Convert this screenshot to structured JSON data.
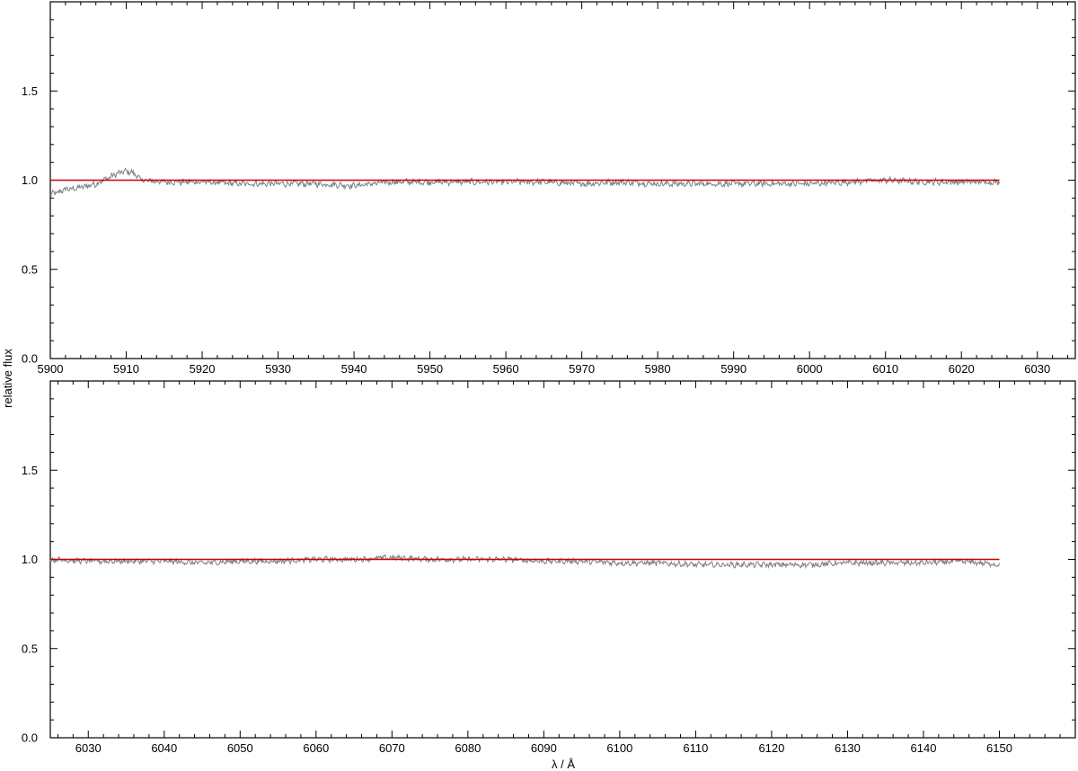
{
  "chart_data": [
    {
      "type": "line",
      "xlim": [
        5900,
        6035
      ],
      "ylim": [
        0,
        2
      ],
      "xticks": [
        5900,
        5910,
        5920,
        5930,
        5940,
        5950,
        5960,
        5970,
        5980,
        5990,
        6000,
        6010,
        6020,
        6030
      ],
      "xtick_labels": [
        "5900",
        "5910",
        "5920",
        "5930",
        "5940",
        "5950",
        "5960",
        "5970",
        "5980",
        "5990",
        "6000",
        "6010",
        "6020",
        "6030"
      ],
      "yticks": [
        0.0,
        0.5,
        1.0,
        1.5
      ],
      "ytick_labels": [
        "0.0",
        "0.5",
        "1.0",
        "1.5"
      ],
      "grid": false,
      "series": [
        {
          "role": "observed spectrum",
          "color": "#808080",
          "x_range": [
            5900,
            6025
          ],
          "points": [
            [
              5900,
              0.92
            ],
            [
              5901,
              0.93
            ],
            [
              5902,
              0.95
            ],
            [
              5903,
              0.95
            ],
            [
              5904,
              0.96
            ],
            [
              5905,
              0.97
            ],
            [
              5906,
              0.98
            ],
            [
              5907,
              1.0
            ],
            [
              5908,
              1.02
            ],
            [
              5909,
              1.04
            ],
            [
              5910,
              1.05
            ],
            [
              5911,
              1.04
            ],
            [
              5912,
              1.0
            ],
            [
              5915,
              0.99
            ],
            [
              5920,
              0.99
            ],
            [
              5925,
              0.98
            ],
            [
              5930,
              0.98
            ],
            [
              5935,
              0.98
            ],
            [
              5940,
              0.97
            ],
            [
              5945,
              0.99
            ],
            [
              5950,
              0.99
            ],
            [
              5955,
              0.99
            ],
            [
              5960,
              0.99
            ],
            [
              5965,
              0.99
            ],
            [
              5970,
              0.98
            ],
            [
              5975,
              0.99
            ],
            [
              5980,
              0.98
            ],
            [
              5985,
              0.98
            ],
            [
              5990,
              0.98
            ],
            [
              5995,
              0.98
            ],
            [
              6000,
              0.98
            ],
            [
              6005,
              0.99
            ],
            [
              6010,
              1.0
            ],
            [
              6015,
              0.99
            ],
            [
              6020,
              0.99
            ],
            [
              6025,
              0.99
            ]
          ],
          "noise_amplitude": 0.015
        },
        {
          "role": "model continuum",
          "color": "#cc0000",
          "points": [
            [
              5900,
              1.0
            ],
            [
              6025,
              1.0
            ]
          ]
        }
      ]
    },
    {
      "type": "line",
      "xlim": [
        6025,
        6160
      ],
      "ylim": [
        0,
        2
      ],
      "xticks": [
        6030,
        6040,
        6050,
        6060,
        6070,
        6080,
        6090,
        6100,
        6110,
        6120,
        6130,
        6140,
        6150
      ],
      "xtick_labels": [
        "6030",
        "6040",
        "6050",
        "6060",
        "6070",
        "6080",
        "6090",
        "6100",
        "6110",
        "6120",
        "6130",
        "6140",
        "6150"
      ],
      "yticks": [
        0.0,
        0.5,
        1.0,
        1.5
      ],
      "ytick_labels": [
        "0.0",
        "0.5",
        "1.0",
        "1.5"
      ],
      "grid": false,
      "series": [
        {
          "role": "observed spectrum",
          "color": "#808080",
          "x_range": [
            6025,
            6150
          ],
          "points": [
            [
              6025,
              1.0
            ],
            [
              6030,
              0.99
            ],
            [
              6035,
              0.99
            ],
            [
              6040,
              0.99
            ],
            [
              6045,
              0.98
            ],
            [
              6050,
              0.99
            ],
            [
              6055,
              0.99
            ],
            [
              6060,
              1.0
            ],
            [
              6065,
              1.0
            ],
            [
              6070,
              1.01
            ],
            [
              6075,
              1.0
            ],
            [
              6080,
              1.0
            ],
            [
              6085,
              1.0
            ],
            [
              6090,
              0.99
            ],
            [
              6095,
              0.99
            ],
            [
              6100,
              0.98
            ],
            [
              6105,
              0.98
            ],
            [
              6110,
              0.97
            ],
            [
              6115,
              0.97
            ],
            [
              6120,
              0.97
            ],
            [
              6125,
              0.97
            ],
            [
              6130,
              0.98
            ],
            [
              6135,
              0.98
            ],
            [
              6140,
              0.98
            ],
            [
              6145,
              0.99
            ],
            [
              6150,
              0.97
            ]
          ],
          "noise_amplitude": 0.013
        },
        {
          "role": "model continuum",
          "color": "#cc0000",
          "points": [
            [
              6025,
              1.0
            ],
            [
              6150,
              1.0
            ]
          ]
        }
      ]
    }
  ],
  "ylabel": "relative flux",
  "xlabel": "λ / Å"
}
